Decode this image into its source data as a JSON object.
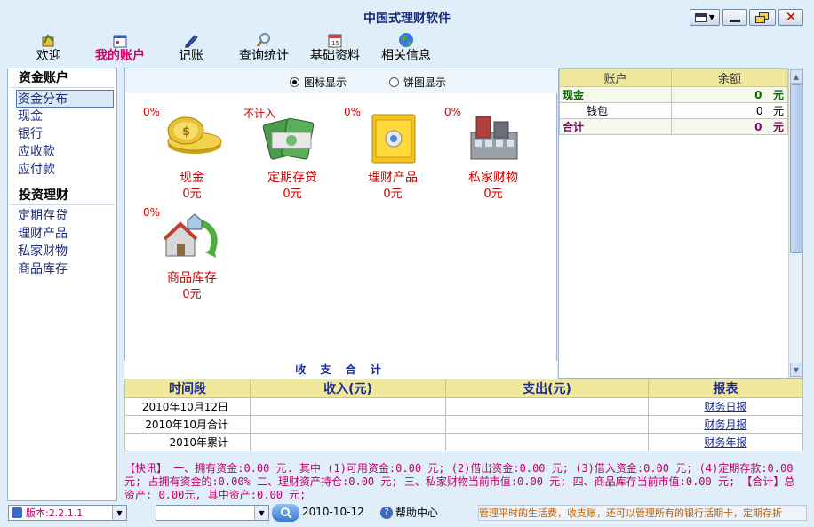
{
  "app": {
    "title": "中国式理财软件"
  },
  "window_buttons": [
    "menu-button",
    "minimize-button",
    "restore-button",
    "close-button"
  ],
  "toolbar": {
    "items": [
      {
        "label": "欢迎",
        "icon": "welcome-icon"
      },
      {
        "label": "我的账户",
        "icon": "account-icon",
        "active": true
      },
      {
        "label": "记账",
        "icon": "pen-icon"
      },
      {
        "label": "查询统计",
        "icon": "search-icon"
      },
      {
        "label": "基础资料",
        "icon": "calendar-icon"
      },
      {
        "label": "相关信息",
        "icon": "globe-icon"
      }
    ]
  },
  "sidebar": {
    "section1": "资金账户",
    "items1": [
      "资金分布",
      "现金",
      "银行",
      "应收款",
      "应付款"
    ],
    "section2": "投资理财",
    "items2": [
      "定期存贷",
      "理财产品",
      "私家财物",
      "商品库存"
    ]
  },
  "view": {
    "icon_view": "图标显示",
    "pie_view": "饼图显示"
  },
  "tiles": [
    {
      "pct": "0%",
      "name": "现金",
      "amount": "0元",
      "icon": "coins-icon"
    },
    {
      "pct": "不计入",
      "name": "定期存贷",
      "amount": "0元",
      "icon": "money-stack-icon"
    },
    {
      "pct": "0%",
      "name": "理财产品",
      "amount": "0元",
      "icon": "safe-icon"
    },
    {
      "pct": "0%",
      "name": "私家财物",
      "amount": "0元",
      "icon": "building-icon"
    },
    {
      "pct": "0%",
      "name": "商品库存",
      "amount": "0元",
      "icon": "house-cycle-icon"
    }
  ],
  "summary_title": "收 支 合 计",
  "accounts": {
    "headers": [
      "账户",
      "余额"
    ],
    "rows": [
      {
        "name": "现金",
        "value": "0",
        "unit": "元",
        "group": true
      },
      {
        "name": "钱包",
        "value": "0",
        "unit": "元",
        "group": false
      },
      {
        "name": "合计",
        "value": "0",
        "unit": "元",
        "group": true
      }
    ]
  },
  "report_table": {
    "headers": [
      "时间段",
      "收入(元)",
      "支出(元)",
      "报表"
    ],
    "rows": [
      {
        "period": "2010年10月12日",
        "income": "",
        "expense": "",
        "report": "财务日报"
      },
      {
        "period": "2010年10月合计",
        "income": "",
        "expense": "",
        "report": "财务月报"
      },
      {
        "period": "2010年累计",
        "income": "",
        "expense": "",
        "report": "财务年报"
      }
    ]
  },
  "news": "【快讯】 一、拥有资金:0.00 元. 其中 (1)可用资金:0.00 元; (2)借出资金:0.00 元; (3)借入资金:0.00 元; (4)定期存款:0.00 元; 占拥有资金的:0.00% 二、理财资产持仓:0.00 元; 三、私家财物当前市值:0.00 元; 四、商品库存当前市值:0.00 元; 【合计】总资产: 0.00元, 其中资产:0.00 元;",
  "status": {
    "version": "版本:2.2.1.1",
    "date": "2010-10-12",
    "help": "帮助中心",
    "marquee": "管理平时的生活费，收支账，还可以管理所有的银行活期卡，定期存折"
  },
  "colors": {
    "accent": "#d4006a",
    "header_bg": "#f0e89a",
    "link": "#1a2a9a",
    "panel_bg": "#dfeef8"
  }
}
